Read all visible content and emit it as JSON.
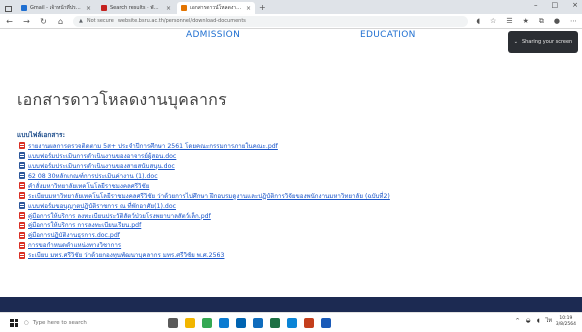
{
  "browser": {
    "tabs": [
      {
        "label": "Gmail - เจ้าหน้าที่ประกัน - Outlook",
        "favicon_color": "#1f6fd1",
        "active": false
      },
      {
        "label": "Search results · พัฒนาบุคลากร",
        "favicon_color": "#c5221f",
        "active": false
      },
      {
        "label": "เอกสารดาวน์โหลดงานบุคลากร",
        "favicon_color": "#e37400",
        "active": true
      }
    ],
    "new_tab": "+",
    "address": {
      "security_label": "Not secure",
      "url": "website.bsru.ac.th/personnel/download-documents"
    }
  },
  "site_nav": {
    "admission": "ADMISSION",
    "education": "EDUCATION"
  },
  "popup": {
    "text": "Sharing your screen"
  },
  "page": {
    "title": "เอกสารดาวโหลดงานบุคลากร",
    "section_label": "แบบไฟล์เอกสาร:",
    "files": [
      {
        "type": "pdf",
        "label": "รายงานผลการตรวจติดตาม 5ส+ ประจำปีการศึกษา 2561 โดยคณะกรรมการภายในคณะ.pdf"
      },
      {
        "type": "doc",
        "label": "แบบฟอร์มประเมินการดำเนินงานของอาจารย์ผู้สอน.doc"
      },
      {
        "type": "doc",
        "label": "แบบฟอร์มประเมินการดำเนินงานของสายสนับสนุน.doc"
      },
      {
        "type": "doc",
        "label": "62 08 30หลักเกณฑ์การประเมินค่างาน (1).doc"
      },
      {
        "type": "pdf",
        "label": "คำสั่งมหาวิทยาลัยเทคโนโลยีราชมงคลศรีวิชัย"
      },
      {
        "type": "pdf",
        "label": "ระเบียบมหาวิทยาลัยเทคโนโลยีราชมงคลศรีวิชัย ว่าด้วยการไปศึกษา ฝึกอบรมดูงานและปฏิบัติการวิจัยของพนักงานมหาวิทยาลัย (ฉบับที่2)"
      },
      {
        "type": "doc",
        "label": "แบบฟอร์มขอนุญาตปฏิบัติราชการ ณ ที่พักอาศัย(1).doc"
      },
      {
        "type": "pdf",
        "label": "คู่มือการให้บริการ ลงทะเบียนประวัติสัตว์ป่วยโรงพยาบาลสัตว์เล็ก.pdf"
      },
      {
        "type": "pdf",
        "label": "คู่มือการให้บริการ การลงทะเบียนเรียน.pdf"
      },
      {
        "type": "pdf",
        "label": "คู่มือการปฏิบัติงานธุรการ.doc.pdf"
      },
      {
        "type": "pdf",
        "label": "การขอกำหนดตำแหน่งทางวิชาการ"
      },
      {
        "type": "pdf",
        "label": "ระเบียบ มทร.ศรีวิชัย ว่าด้วยกองทุนพัฒนาบุคลากร มทร.ศรีวิชัย พ.ศ.2563"
      }
    ]
  },
  "taskbar": {
    "search_placeholder": "Type here to search",
    "apps": [
      {
        "name": "task-view",
        "color": "#5a5a5a"
      },
      {
        "name": "file-explorer",
        "color": "#f2b600"
      },
      {
        "name": "chrome",
        "color": "#34a853"
      },
      {
        "name": "edge",
        "color": "#0b7bd1"
      },
      {
        "name": "store",
        "color": "#0063b1"
      },
      {
        "name": "outlook",
        "color": "#0f6cbd"
      },
      {
        "name": "excel",
        "color": "#1d7044"
      },
      {
        "name": "photos",
        "color": "#0a84d6"
      },
      {
        "name": "powerpoint",
        "color": "#c43e1c"
      },
      {
        "name": "word",
        "color": "#1a5ab8"
      }
    ],
    "clock_time": "10:19",
    "clock_date": "3/8/2564"
  }
}
